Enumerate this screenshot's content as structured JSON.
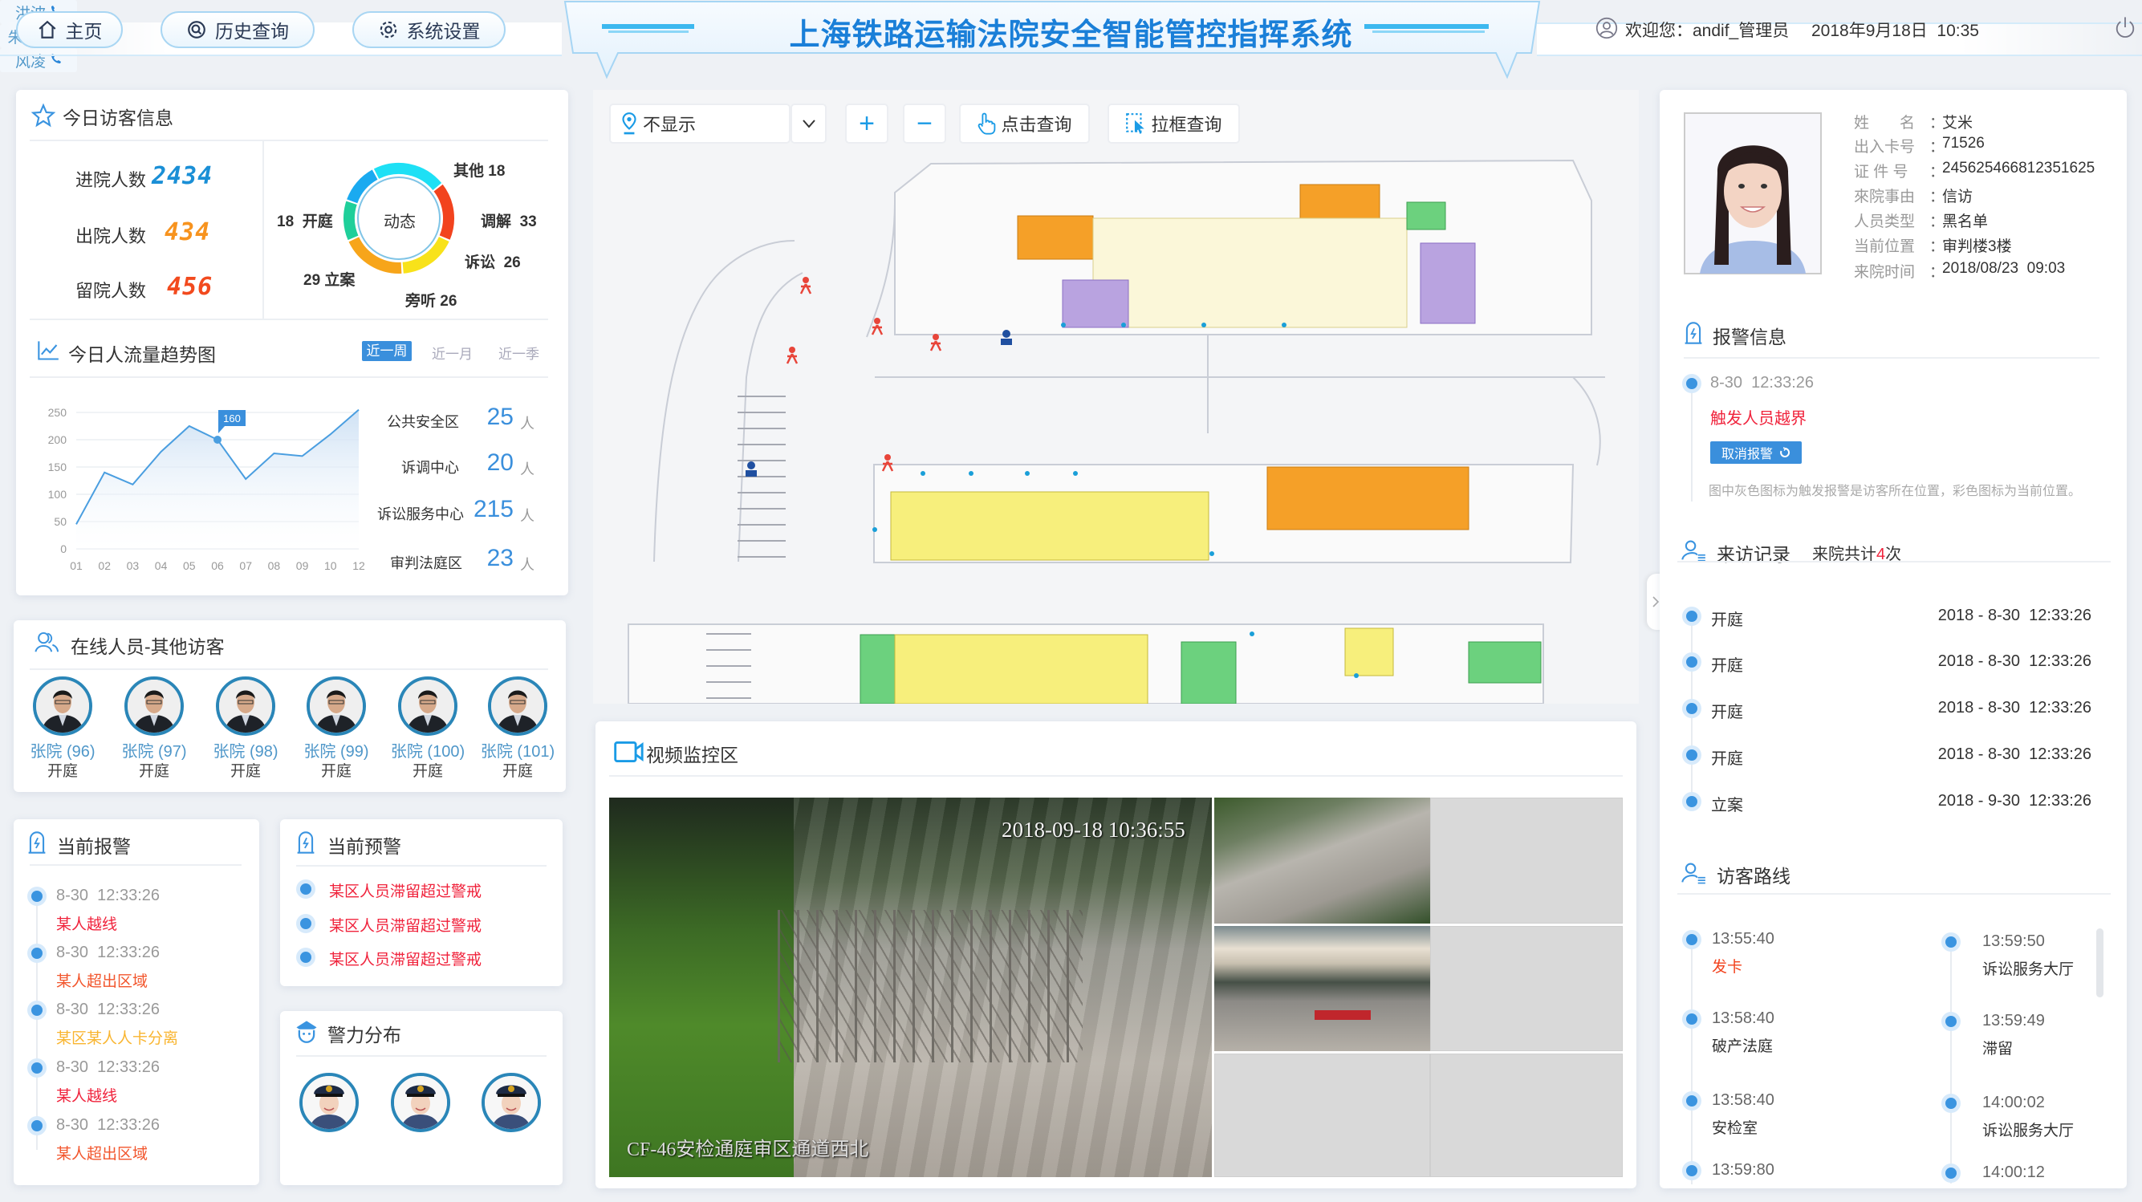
{
  "header": {
    "title": "上海铁路运输法院安全智能管控指挥系统",
    "nav": [
      {
        "label": "主页",
        "icon": "home-icon"
      },
      {
        "label": "历史查询",
        "icon": "history-search-icon"
      },
      {
        "label": "系统设置",
        "icon": "gear-icon"
      }
    ],
    "welcome": "欢迎您：andif_管理员",
    "datetime": "2018年9月18日  10:35",
    "accent": "#1a7fd8"
  },
  "visitors": {
    "title": "今日访客信息",
    "stats": [
      {
        "label": "进院人数",
        "value": "2434",
        "color": "#1a8fd6"
      },
      {
        "label": "出院人数",
        "value": "434",
        "color": "#f7931e"
      },
      {
        "label": "留院人数",
        "value": "456",
        "color": "#f24a1e"
      }
    ],
    "donut": {
      "center": "动态",
      "segments": [
        {
          "name": "其他",
          "value": 18,
          "color": "#1aaaf0"
        },
        {
          "name": "调解",
          "value": 33,
          "color": "#1ee0f5"
        },
        {
          "name": "诉讼",
          "value": 26,
          "color": "#f2431e"
        },
        {
          "name": "旁听",
          "value": 26,
          "color": "#f8e21a"
        },
        {
          "name": "立案",
          "value": 29,
          "color": "#f7a51a"
        },
        {
          "name": "开庭",
          "value": 18,
          "color": "#1fcf9a"
        }
      ]
    }
  },
  "trend": {
    "title": "今日人流量趋势图",
    "tabs": [
      {
        "label": "近一周",
        "active": true
      },
      {
        "label": "近一月",
        "active": false
      },
      {
        "label": "近一季",
        "active": false
      }
    ],
    "areas": [
      {
        "label": "公共安全区",
        "value": "25",
        "unit": "人"
      },
      {
        "label": "诉调中心",
        "value": "20",
        "unit": "人"
      },
      {
        "label": "诉讼服务中心",
        "value": "215",
        "unit": "人"
      },
      {
        "label": "审判法庭区",
        "value": "23",
        "unit": "人"
      }
    ]
  },
  "chart_data": {
    "type": "area",
    "categories": [
      "01",
      "02",
      "03",
      "04",
      "05",
      "06",
      "07",
      "08",
      "09",
      "10",
      "12"
    ],
    "values": [
      45,
      140,
      118,
      178,
      225,
      200,
      128,
      175,
      170,
      210,
      255
    ],
    "highlight": {
      "category": "06",
      "label": "160"
    },
    "ylim": [
      0,
      250
    ],
    "yticks": [
      0,
      50,
      100,
      150,
      200,
      250
    ],
    "grid": true,
    "color": "#4a9ee0"
  },
  "online": {
    "title": "在线人员-其他访客",
    "people": [
      {
        "name": "张院 (96)",
        "status": "开庭"
      },
      {
        "name": "张院 (97)",
        "status": "开庭"
      },
      {
        "name": "张院 (98)",
        "status": "开庭"
      },
      {
        "name": "张院 (99)",
        "status": "开庭"
      },
      {
        "name": "张院 (100)",
        "status": "开庭"
      },
      {
        "name": "张院 (101)",
        "status": "开庭"
      }
    ]
  },
  "alarms": {
    "title": "当前报警",
    "items": [
      {
        "time": "8-30  12:33:26",
        "text": "某人越线",
        "color": "#f0233c"
      },
      {
        "time": "8-30  12:33:26",
        "text": "某人超出区域",
        "color": "#f2552c"
      },
      {
        "time": "8-30  12:33:26",
        "text": "某区某人人卡分离",
        "color": "#f9b530"
      },
      {
        "time": "8-30  12:33:26",
        "text": "某人越线",
        "color": "#f0233c"
      },
      {
        "time": "8-30  12:33:26",
        "text": "某人超出区域",
        "color": "#f2552c"
      }
    ]
  },
  "warnings": {
    "title": "当前预警",
    "items": [
      "某区人员滞留超过警戒",
      "某区人员滞留超过警戒",
      "某区人员滞留超过警戒"
    ]
  },
  "police": {
    "title": "警力分布",
    "officers": [
      {
        "name": "洪波",
        "icon": "phone-icon"
      },
      {
        "name": "朱亚东",
        "icon": "phone-icon"
      },
      {
        "name": "风凌",
        "icon": "phone-icon"
      }
    ]
  },
  "map": {
    "display_select": "不显示",
    "zoom_in": "+",
    "zoom_out": "−",
    "click_query": "点击查询",
    "box_query": "拉框查询"
  },
  "video": {
    "title": "视频监控区",
    "timestamp": "2018-09-18 10:36:55",
    "caption": "CF-46安检通庭审区通道西北"
  },
  "profile": {
    "fields": [
      {
        "label": "姓　　名",
        "value": "艾米"
      },
      {
        "label": "出入卡号",
        "value": "71526"
      },
      {
        "label": "证 件 号",
        "value": "245625466812351625"
      },
      {
        "label": "來院事由",
        "value": "信访"
      },
      {
        "label": "人员类型",
        "value": "黑名单"
      },
      {
        "label": "当前位置",
        "value": "审判楼3楼"
      },
      {
        "label": "来院时间",
        "value": "2018/08/23  09:03"
      }
    ]
  },
  "alarm_info": {
    "title": "报警信息",
    "time": "8-30  12:33:26",
    "text": "触发人员越界",
    "cancel_button": "取消报警",
    "note": "图中灰色图标为触发报警是访客所在位置，彩色图标为当前位置。"
  },
  "visit_records": {
    "title": "来访记录",
    "summary_prefix": "来院共计",
    "summary_count": "4",
    "summary_suffix": "次",
    "items": [
      {
        "type": "开庭",
        "time": "2018 - 8-30  12:33:26"
      },
      {
        "type": "开庭",
        "time": "2018 - 8-30  12:33:26"
      },
      {
        "type": "开庭",
        "time": "2018 - 8-30  12:33:26"
      },
      {
        "type": "开庭",
        "time": "2018 - 8-30  12:33:26"
      },
      {
        "type": "立案",
        "time": "2018 - 9-30  12:33:26"
      }
    ]
  },
  "route": {
    "title": "访客路线",
    "left": [
      {
        "time": "13:55:40",
        "place": "发卡",
        "color": "#f2431e"
      },
      {
        "time": "13:58:40",
        "place": "破产法庭",
        "color": "#333333"
      },
      {
        "time": "13:58:40",
        "place": "安检室",
        "color": "#333333"
      },
      {
        "time": "13:59:80",
        "place": "",
        "color": "#333333"
      }
    ],
    "right": [
      {
        "time": "13:59:50",
        "place": "诉讼服务大厅"
      },
      {
        "time": "13:59:49",
        "place": "滞留"
      },
      {
        "time": "14:00:02",
        "place": "诉讼服务大厅"
      },
      {
        "time": "14:00:12",
        "place": ""
      }
    ]
  }
}
